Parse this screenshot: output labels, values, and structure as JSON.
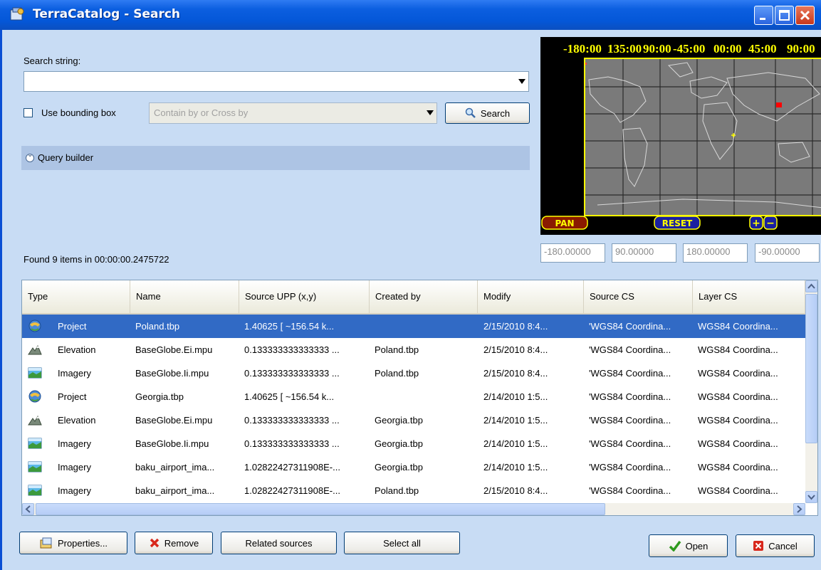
{
  "window": {
    "title": "TerraCatalog - Search"
  },
  "search": {
    "label": "Search string:",
    "value": "",
    "bbox_label": "Use bounding box",
    "bbox_checked": false,
    "mode_placeholder": "Contain by or Cross by",
    "search_button": "Search"
  },
  "query_builder": {
    "label": "Query builder"
  },
  "status": {
    "found_text": "Found 9 items in 00:00:00.2475722"
  },
  "map": {
    "lon_labels": [
      "-180:00",
      "135:00",
      "90:00",
      "-45:00",
      "00:00",
      "45:00",
      "90:00"
    ],
    "pan_label": "PAN",
    "reset_label": "RESET",
    "zoom_in": "+",
    "zoom_out": "−",
    "bounds": [
      "-180.00000",
      "90.00000",
      "180.00000",
      "-90.00000"
    ]
  },
  "table": {
    "columns": [
      "Type",
      "Name",
      "Source UPP (x,y)",
      "Created by",
      "Modify",
      "Source CS",
      "Layer CS"
    ],
    "rows": [
      {
        "icon": "project-icon",
        "type": "Project",
        "name": "Poland.tbp",
        "upp": "1.40625 [ ~156.54 k...",
        "created_by": "",
        "modify": "2/15/2010 8:4...",
        "source_cs": "'WGS84 Coordina...",
        "layer_cs": "WGS84 Coordina...",
        "selected": true
      },
      {
        "icon": "elevation-icon",
        "type": "Elevation",
        "name": "BaseGlobe.Ei.mpu",
        "upp": "0.133333333333333 ...",
        "created_by": "Poland.tbp",
        "modify": "2/15/2010 8:4...",
        "source_cs": "'WGS84 Coordina...",
        "layer_cs": "WGS84 Coordina...",
        "selected": false
      },
      {
        "icon": "imagery-icon",
        "type": "Imagery",
        "name": "BaseGlobe.Ii.mpu",
        "upp": "0.133333333333333 ...",
        "created_by": "Poland.tbp",
        "modify": "2/15/2010 8:4...",
        "source_cs": "'WGS84 Coordina...",
        "layer_cs": "WGS84 Coordina...",
        "selected": false
      },
      {
        "icon": "project-icon",
        "type": "Project",
        "name": "Georgia.tbp",
        "upp": "1.40625 [ ~156.54 k...",
        "created_by": "",
        "modify": "2/14/2010 1:5...",
        "source_cs": "'WGS84 Coordina...",
        "layer_cs": "WGS84 Coordina...",
        "selected": false
      },
      {
        "icon": "elevation-icon",
        "type": "Elevation",
        "name": "BaseGlobe.Ei.mpu",
        "upp": "0.133333333333333 ...",
        "created_by": "Georgia.tbp",
        "modify": "2/14/2010 1:5...",
        "source_cs": "'WGS84 Coordina...",
        "layer_cs": "WGS84 Coordina...",
        "selected": false
      },
      {
        "icon": "imagery-icon",
        "type": "Imagery",
        "name": "BaseGlobe.Ii.mpu",
        "upp": "0.133333333333333 ...",
        "created_by": "Georgia.tbp",
        "modify": "2/14/2010 1:5...",
        "source_cs": "'WGS84 Coordina...",
        "layer_cs": "WGS84 Coordina...",
        "selected": false
      },
      {
        "icon": "imagery-icon",
        "type": "Imagery",
        "name": "baku_airport_ima...",
        "upp": "1.02822427311908E-...",
        "created_by": "Georgia.tbp",
        "modify": "2/14/2010 1:5...",
        "source_cs": "'WGS84 Coordina...",
        "layer_cs": "WGS84 Coordina...",
        "selected": false
      },
      {
        "icon": "imagery-icon",
        "type": "Imagery",
        "name": "baku_airport_ima...",
        "upp": "1.02822427311908E-...",
        "created_by": "Poland.tbp",
        "modify": "2/15/2010 8:4...",
        "source_cs": "'WGS84 Coordina...",
        "layer_cs": "WGS84 Coordina...",
        "selected": false
      }
    ]
  },
  "buttons": {
    "properties": "Properties...",
    "remove": "Remove",
    "related_sources": "Related sources",
    "select_all": "Select all",
    "open": "Open",
    "cancel": "Cancel"
  },
  "colors": {
    "titlebar": "#0457d8",
    "dialog_bg": "#c8dcf4",
    "selection": "#316ac5",
    "map_accent": "#ffff00"
  }
}
